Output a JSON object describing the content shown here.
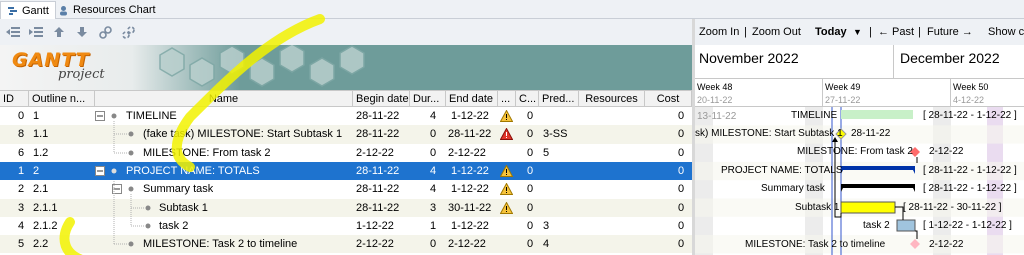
{
  "tabs": [
    {
      "label": "Gantt"
    },
    {
      "label": "Resources Chart"
    }
  ],
  "banner": {
    "logo_main": "GANTT",
    "logo_sub": "project"
  },
  "columns": [
    "ID",
    "Outline n...",
    "Name",
    "Begin date",
    "Dur...",
    "End date",
    "...",
    "C...",
    "Pred...",
    "Resources",
    "Cost"
  ],
  "rows": [
    {
      "id": "0",
      "outline": "1",
      "name": "TIMELINE",
      "begin": "28-11-22",
      "dur": "4",
      "end": "1-12-22",
      "warn": "yellow",
      "comp": "0",
      "pred": "",
      "cost": "0"
    },
    {
      "id": "8",
      "outline": "1.1",
      "name": "(fake task) MILESTONE: Start Subtask 1",
      "begin": "28-11-22",
      "dur": "0",
      "end": "28-11-22",
      "warn": "red",
      "comp": "0",
      "pred": "3-SS",
      "cost": "0"
    },
    {
      "id": "6",
      "outline": "1.2",
      "name": "MILESTONE: From task 2",
      "begin": "2-12-22",
      "dur": "0",
      "end": "2-12-22",
      "warn": "",
      "comp": "0",
      "pred": "5",
      "cost": "0"
    },
    {
      "id": "1",
      "outline": "2",
      "name": "PROJECT NAME: TOTALS",
      "begin": "28-11-22",
      "dur": "4",
      "end": "1-12-22",
      "warn": "yellow",
      "comp": "0",
      "pred": "",
      "cost": "0"
    },
    {
      "id": "2",
      "outline": "2.1",
      "name": "Summary task",
      "begin": "28-11-22",
      "dur": "4",
      "end": "1-12-22",
      "warn": "yellow",
      "comp": "0",
      "pred": "",
      "cost": "0"
    },
    {
      "id": "3",
      "outline": "2.1.1",
      "name": "Subtask 1",
      "begin": "28-11-22",
      "dur": "3",
      "end": "30-11-22",
      "warn": "yellow",
      "comp": "0",
      "pred": "",
      "cost": "0"
    },
    {
      "id": "4",
      "outline": "2.1.2",
      "name": "task 2",
      "begin": "1-12-22",
      "dur": "1",
      "end": "1-12-22",
      "warn": "",
      "comp": "0",
      "pred": "3",
      "cost": "0"
    },
    {
      "id": "5",
      "outline": "2.2",
      "name": "MILESTONE: Task 2 to timeline",
      "begin": "2-12-22",
      "dur": "0",
      "end": "2-12-22",
      "warn": "",
      "comp": "0",
      "pred": "4",
      "cost": "0"
    }
  ],
  "chart_toolbar": {
    "zoom_in": "Zoom In",
    "sep1": "|",
    "zoom_out": "Zoom Out",
    "today": "Today",
    "sep2": "|",
    "past": "← Past",
    "sep3": "|",
    "future": "Future →",
    "show": "Show cr"
  },
  "months": [
    "November 2022",
    "December 2022"
  ],
  "weeks": [
    {
      "label": "Week 48",
      "date": "20-11-22"
    },
    {
      "label": "Week 49",
      "date": "27-11-22"
    },
    {
      "label": "Week 50",
      "date": "4-12-22"
    }
  ],
  "chart_labels": [
    {
      "text": "TIMELINE"
    },
    {
      "text": "[ 28-11-22 - 1-12-22 ]"
    },
    {
      "text": "sk) MILESTONE: Start Subtask 1"
    },
    {
      "text": "28-11-22"
    },
    {
      "text": "MILESTONE: From task 2"
    },
    {
      "text": "2-12-22"
    },
    {
      "text": "PROJECT NAME: TOTALS"
    },
    {
      "text": "[ 28-11-22 - 1-12-22 ]"
    },
    {
      "text": "Summary task"
    },
    {
      "text": "[ 28-11-22 - 1-12-22 ]"
    },
    {
      "text": "Subtask 1"
    },
    {
      "text": "[ 28-11-22 - 30-11-22 ]"
    },
    {
      "text": "task 2"
    },
    {
      "text": "[ 1-12-22 - 1-12-22 ]"
    },
    {
      "text": "MILESTONE: Task 2 to timeline"
    },
    {
      "text": "2-12-22"
    },
    {
      "text": "13-11-22"
    }
  ],
  "colors": {
    "selection": "#1e73cf",
    "accent_orange": "#f08a12",
    "bar_yellow": "#ffff00",
    "bar_blue": "#a0c4de",
    "timeline_green": "#c8f0c8",
    "milestone_red": "#ff6b6b"
  }
}
